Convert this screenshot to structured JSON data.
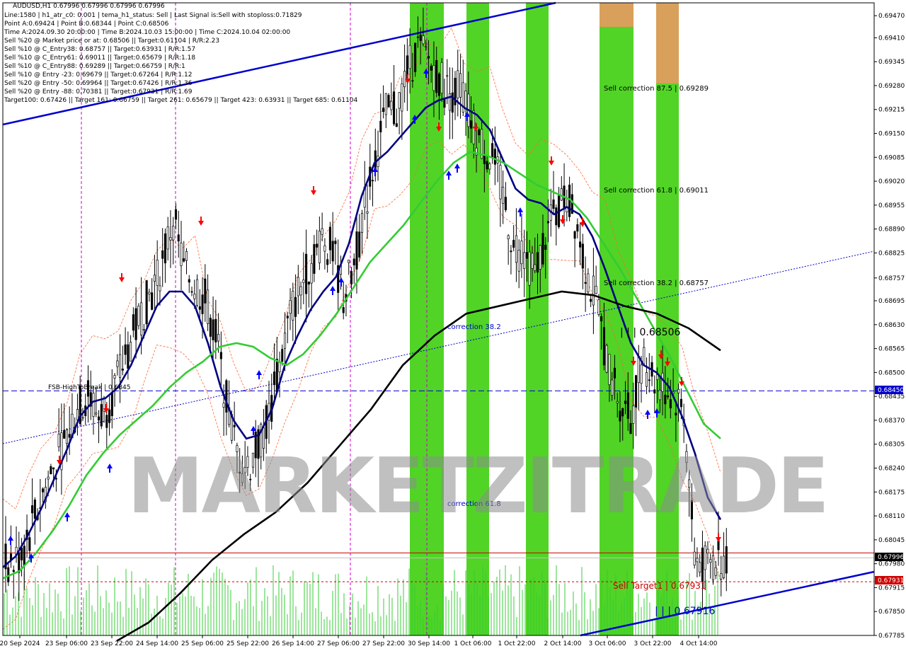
{
  "header": {
    "symbol_line": "AUDUSD,H1  0.67996 0.67996 0.67996 0.67996",
    "lines": [
      "Line:1580 | h1_atr_c0: 0.001 | tema_h1_status: Sell | Last Signal is:Sell with stoploss:0.71829",
      "Point A:0.69424 | Point B:0.68344 | Point C:0.68506",
      "Time A:2024.09.30 20:00:00 | Time B:2024.10.03 15:00:00 | Time C:2024.10.04 02:00:00",
      "Sell %20 @ Market price or at: 0.68506 || Target:0.61104 | R/R:2.23",
      "Sell %10 @ C_Entry38: 0.68757 || Target:0.63931 | R/R:1.57",
      "Sell %10 @ C_Entry61: 0.69011 || Target:0.65679 | R/R:1.18",
      "Sell %10 @ C_Entry88: 0.69289 || Target:0.66759 | R/R:1",
      "Sell %10 @ Entry -23: 0.69679 || Target:0.67264 | R/R:1.12",
      "Sell %20 @ Entry -50: 0.69964 || Target:0.67426 | R/R:1.36",
      "Sell %20 @ Entry -88: 0.70381 || Target:0.67931 | R/R:1.69",
      "Target100: 0.67426 || Target 161: 0.66759 || Target 261: 0.65679 || Target 423: 0.63931 || Target 685: 0.61104"
    ]
  },
  "watermark": "MARKETZITRADE",
  "labels": {
    "sell_c875": "Sell correction 87.5 | 0.69289",
    "sell_c618": "Sell correction 61.8 | 0.69011",
    "sell_c382": "Sell correction 38.2 | 0.68757",
    "corr382": "correction 38.2",
    "corr618": "correction 61.8",
    "point_c": "| | | 0.68506",
    "fsb": "FSB-HighToBreak | 0.6845",
    "sell_target": "Sell Target1 | 0.67931",
    "point_b": "| | | 0.67916"
  },
  "price_tags": {
    "fsb": "0.68450",
    "current": "0.67996",
    "target": "0.67931"
  },
  "colors": {
    "background": "#ffffff",
    "green_band": "#33cc00",
    "orange_band": "#d9a05b",
    "navy": "#000080",
    "blue_line": "#0000cd",
    "green_ma": "#33cc33",
    "black_ma": "#000000",
    "red_arrow": "#ff0000",
    "blue_arrow": "#0000ff",
    "fsb_line": "#0000cd",
    "target_line": "#cc0000",
    "volume": "#33cc33",
    "candle": "#000000"
  },
  "chart_data": {
    "type": "candlestick",
    "symbol": "AUDUSD",
    "timeframe": "H1",
    "ylim": [
      0.67785,
      0.69505
    ],
    "y_ticks": [
      "0.69470",
      "0.69410",
      "0.69345",
      "0.69280",
      "0.69215",
      "0.69150",
      "0.69085",
      "0.69020",
      "0.68955",
      "0.68890",
      "0.68825",
      "0.68757",
      "0.68695",
      "0.68630",
      "0.68565",
      "0.68500",
      "0.68435",
      "0.68370",
      "0.68305",
      "0.68240",
      "0.68175",
      "0.68110",
      "0.68045",
      "0.67980",
      "0.67915",
      "0.67850",
      "0.67785"
    ],
    "x_ticks": [
      "20 Sep 2024",
      "23 Sep 06:00",
      "23 Sep 22:00",
      "24 Sep 14:00",
      "25 Sep 06:00",
      "25 Sep 22:00",
      "26 Sep 14:00",
      "27 Sep 06:00",
      "27 Sep 22:00",
      "30 Sep 14:00",
      "1 Oct 06:00",
      "1 Oct 22:00",
      "2 Oct 14:00",
      "3 Oct 06:00",
      "3 Oct 22:00",
      "4 Oct 14:00"
    ],
    "close_path": [
      0.6798,
      0.6802,
      0.6811,
      0.6819,
      0.6826,
      0.6833,
      0.684,
      0.6844,
      0.6838,
      0.6842,
      0.685,
      0.6858,
      0.6866,
      0.6872,
      0.688,
      0.6892,
      0.6878,
      0.6874,
      0.687,
      0.686,
      0.6842,
      0.6828,
      0.6824,
      0.683,
      0.6838,
      0.6852,
      0.6866,
      0.6874,
      0.688,
      0.6887,
      0.6883,
      0.6871,
      0.6879,
      0.6895,
      0.6909,
      0.692,
      0.6921,
      0.6932,
      0.6938,
      0.6935,
      0.693,
      0.6926,
      0.6928,
      0.6918,
      0.6912,
      0.6908,
      0.6898,
      0.6884,
      0.6883,
      0.6876,
      0.6888,
      0.6893,
      0.6898,
      0.689,
      0.6876,
      0.6866,
      0.685,
      0.6842,
      0.6838,
      0.6853,
      0.685,
      0.6846,
      0.6844,
      0.684,
      0.68,
      0.6797,
      0.6799,
      0.68
    ],
    "series": [
      {
        "name": "",
        "color": "#000080",
        "values": [
          0.6797,
          0.68,
          0.6806,
          0.6813,
          0.6821,
          0.6829,
          0.6838,
          0.6842,
          0.6843,
          0.6846,
          0.6852,
          0.686,
          0.6868,
          0.6872,
          0.6872,
          0.6868,
          0.6858,
          0.6846,
          0.6837,
          0.6832,
          0.6833,
          0.684,
          0.6852,
          0.686,
          0.6867,
          0.6872,
          0.6876,
          0.6885,
          0.6898,
          0.6907,
          0.691,
          0.6914,
          0.6918,
          0.6922,
          0.6924,
          0.6925,
          0.6922,
          0.692,
          0.6916,
          0.6908,
          0.69,
          0.6897,
          0.6896,
          0.6893,
          0.6895,
          0.6893,
          0.6887,
          0.6878,
          0.6868,
          0.6858,
          0.6852,
          0.685,
          0.6846,
          0.6838,
          0.6828,
          0.6816,
          0.681
        ]
      },
      {
        "name": "",
        "color": "#33cc33",
        "values": [
          0.6794,
          0.6796,
          0.6801,
          0.6807,
          0.6814,
          0.6822,
          0.6828,
          0.6833,
          0.6837,
          0.6841,
          0.6846,
          0.685,
          0.6853,
          0.6857,
          0.6858,
          0.6857,
          0.6854,
          0.6852,
          0.6855,
          0.686,
          0.6866,
          0.6873,
          0.688,
          0.6885,
          0.689,
          0.6896,
          0.6902,
          0.6907,
          0.691,
          0.6909,
          0.6907,
          0.6904,
          0.6901,
          0.6899,
          0.6897,
          0.6892,
          0.6885,
          0.6878,
          0.687,
          0.6862,
          0.6854,
          0.6845,
          0.6836,
          0.6832
        ]
      },
      {
        "name": "",
        "color": "#000000",
        "values": [
          0.6777,
          0.6782,
          0.679,
          0.6799,
          0.6806,
          0.6812,
          0.682,
          0.683,
          0.684,
          0.6852,
          0.686,
          0.6866,
          0.6868,
          0.687,
          0.6872,
          0.6871,
          0.6868,
          0.6866,
          0.6862,
          0.6856
        ]
      }
    ]
  }
}
